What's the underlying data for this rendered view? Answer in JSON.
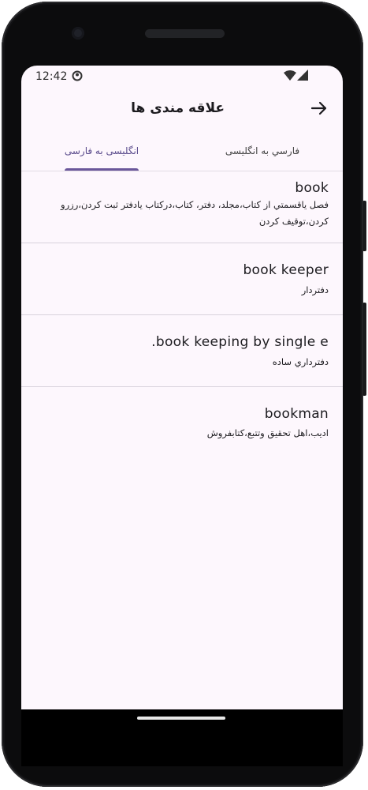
{
  "status": {
    "time": "12:42"
  },
  "appbar": {
    "title": "علاقه مندی ها"
  },
  "tabs": [
    {
      "label": "فارسي به انگلیسی",
      "selected": false
    },
    {
      "label": "انگلیسی به فارسی",
      "selected": true
    }
  ],
  "entries": [
    {
      "word": "book",
      "meaning": "فصل  ياقسمتي  از كتاب،مجلد، دفتر، كتاب،دركتاب يادفتر ثبت كردن،رزرو كردن،توقيف كردن"
    },
    {
      "word": "book keeper",
      "meaning": "دفتردار"
    },
    {
      "word": "book keeping by single e.",
      "meaning": "دفترداري  ساده"
    },
    {
      "word": "bookman",
      "meaning": "اديب،اهل  تحقيق  وتتبع،كتابفروش"
    }
  ],
  "colors": {
    "accent": "#6a579a",
    "background": "#fdf7fd"
  }
}
